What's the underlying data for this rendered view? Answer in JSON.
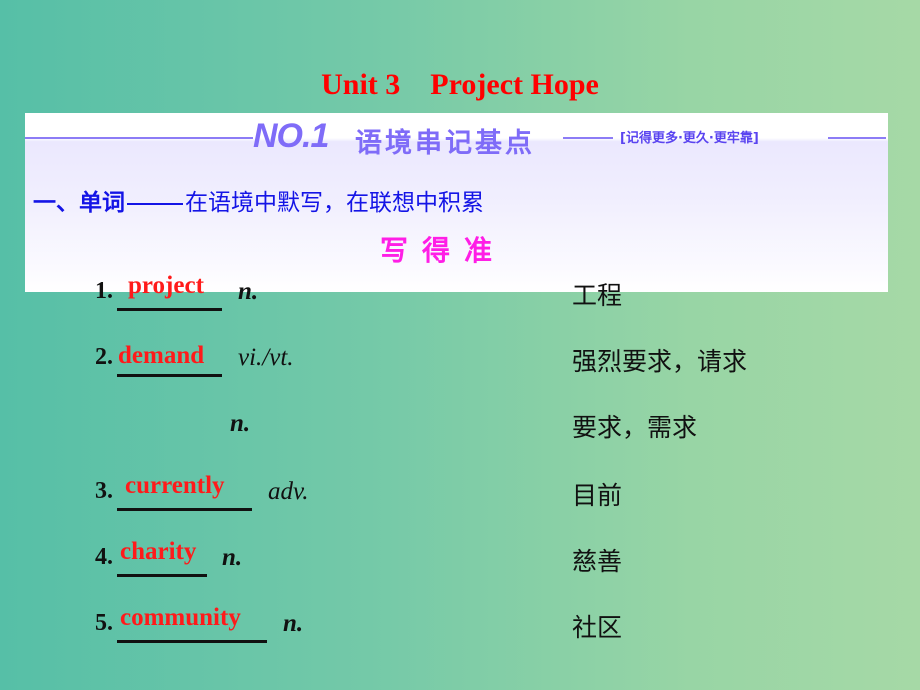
{
  "page": {
    "title": "Unit 3    Project Hope"
  },
  "banner": {
    "number": "NO.1",
    "title": "语境串记基点",
    "tag": "[记得更多·更久·更牢靠]",
    "line_color": "#8c7cf6"
  },
  "section": {
    "heading_strong": "一、单词",
    "heading_rest": "在语境中默写，在联想中积累",
    "sub_heading": "写得准"
  },
  "vocab": [
    {
      "num": "1.",
      "answer": "project",
      "pos": "n.",
      "meaning": "工程"
    },
    {
      "num": "2.",
      "answer": "demand",
      "pos": "vi./vt.",
      "meaning": "强烈要求，请求"
    },
    {
      "num": "",
      "answer": "",
      "pos": "n.",
      "meaning": "要求，需求"
    },
    {
      "num": "3.",
      "answer": "currently",
      "pos": "adv.",
      "meaning": "目前"
    },
    {
      "num": "4.",
      "answer": "charity",
      "pos": "n.",
      "meaning": "慈善"
    },
    {
      "num": "5.",
      "answer": "community",
      "pos": "n.",
      "meaning": "社区"
    }
  ],
  "colors": {
    "title": "#ff0000",
    "answer": "#ff1a1a",
    "heading": "#1414e6",
    "sub_heading": "#ff1ee6",
    "banner_text": "#7f6cf8"
  }
}
